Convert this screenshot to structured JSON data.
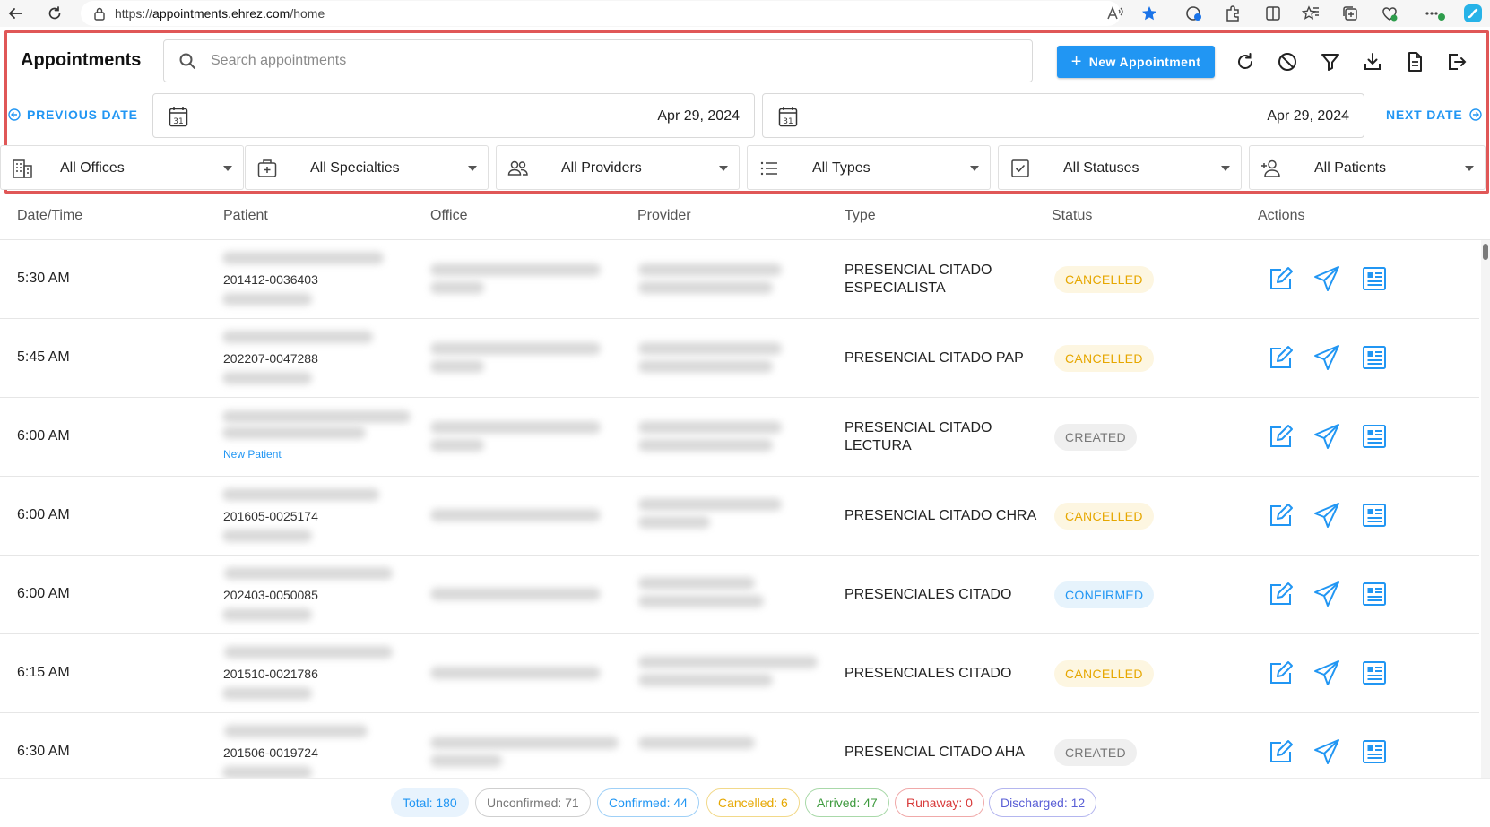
{
  "browser": {
    "url_prefix": "https://",
    "url_host": "appointments.ehrez.com",
    "url_path": "/home"
  },
  "header": {
    "title": "Appointments",
    "search_placeholder": "Search appointments",
    "new_button": "New Appointment"
  },
  "dates": {
    "previous_label": "PREVIOUS DATE",
    "next_label": "NEXT DATE",
    "start_date": "Apr 29, 2024",
    "end_date": "Apr 29, 2024",
    "calendar_day": "31"
  },
  "filters": {
    "offices": "All Offices",
    "specialties": "All Specialties",
    "providers": "All Providers",
    "types": "All Types",
    "statuses": "All Statuses",
    "patients": "All Patients"
  },
  "table": {
    "columns": {
      "datetime": "Date/Time",
      "patient": "Patient",
      "office": "Office",
      "provider": "Provider",
      "type": "Type",
      "status": "Status",
      "actions": "Actions"
    },
    "rows": [
      {
        "time": "5:30 AM",
        "patient_id": "201412-0036403",
        "type": "PRESENCIAL CITADO ESPECIALISTA",
        "status": "CANCELLED"
      },
      {
        "time": "5:45 AM",
        "patient_id": "202207-0047288",
        "type": "PRESENCIAL CITADO PAP",
        "status": "CANCELLED"
      },
      {
        "time": "6:00 AM",
        "new_patient": "New Patient",
        "type": "PRESENCIAL CITADO LECTURA",
        "status": "CREATED"
      },
      {
        "time": "6:00 AM",
        "patient_id": "201605-0025174",
        "type": "PRESENCIAL CITADO CHRA",
        "status": "CANCELLED"
      },
      {
        "time": "6:00 AM",
        "patient_id": "202403-0050085",
        "type": "PRESENCIALES CITADO",
        "status": "CONFIRMED"
      },
      {
        "time": "6:15 AM",
        "patient_id": "201510-0021786",
        "type": "PRESENCIALES CITADO",
        "status": "CANCELLED"
      },
      {
        "time": "6:30 AM",
        "patient_id": "201506-0019724",
        "type": "PRESENCIAL CITADO AHA",
        "status": "CREATED"
      }
    ]
  },
  "summary": {
    "total": "Total: 180",
    "unconfirmed": "Unconfirmed: 71",
    "confirmed": "Confirmed: 44",
    "cancelled": "Cancelled: 6",
    "arrived": "Arrived: 47",
    "runaway": "Runaway: 0",
    "discharged": "Discharged: 12"
  },
  "colors": {
    "accent": "#2196f3",
    "highlight_border": "#e05757",
    "cancelled": "#e6a700",
    "created": "#777777",
    "confirmed": "#2196f3",
    "arrived": "#3d9a3d",
    "runaway": "#d83a3a",
    "discharged": "#5a5fd6"
  },
  "icons": {
    "browser": [
      "back-icon",
      "reload-icon",
      "lock-icon",
      "read-aloud-icon",
      "favorite-star-icon",
      "shield-icon",
      "extensions-icon",
      "split-screen-icon",
      "favorites-icon",
      "collections-icon",
      "health-icon",
      "more-icon",
      "copilot-icon"
    ],
    "toolbar": [
      "refresh-icon",
      "block-icon",
      "filter-icon",
      "download-icon",
      "document-icon",
      "logout-icon"
    ],
    "row_actions": [
      "edit-icon",
      "send-icon",
      "details-icon"
    ]
  }
}
